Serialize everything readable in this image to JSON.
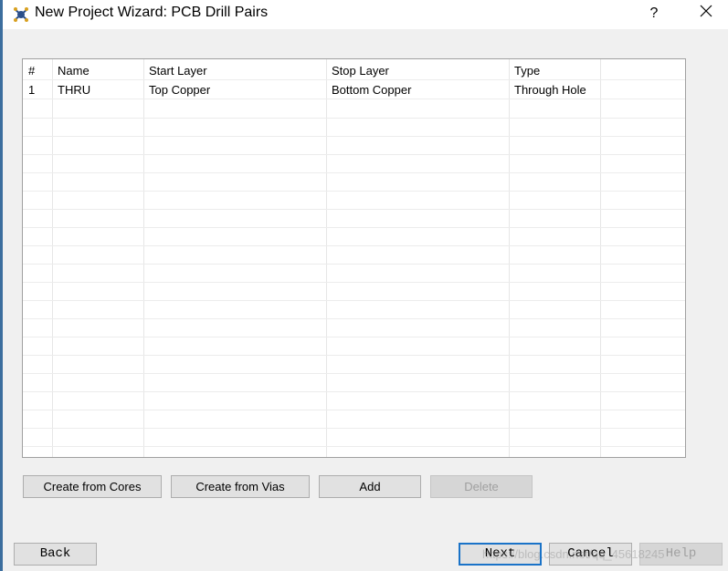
{
  "window": {
    "title": "New Project Wizard: PCB Drill Pairs",
    "help_label": "?"
  },
  "table": {
    "columns": [
      "#",
      "Name",
      "Start Layer",
      "Stop Layer",
      "Type"
    ],
    "rows": [
      [
        "1",
        "THRU",
        "Top Copper",
        "Bottom Copper",
        "Through Hole"
      ]
    ]
  },
  "actions": {
    "create_from_cores": "Create from Cores",
    "create_from_vias": "Create from Vias",
    "add": "Add",
    "delete": "Delete"
  },
  "navigation": {
    "back": "Back",
    "next": "Next",
    "cancel": "Cancel",
    "help": "Help"
  },
  "watermark": "https://blog.csdn.net/qq_45618245",
  "colors": {
    "accent": "#1a73c8",
    "window_bg": "#f0f0f0"
  }
}
